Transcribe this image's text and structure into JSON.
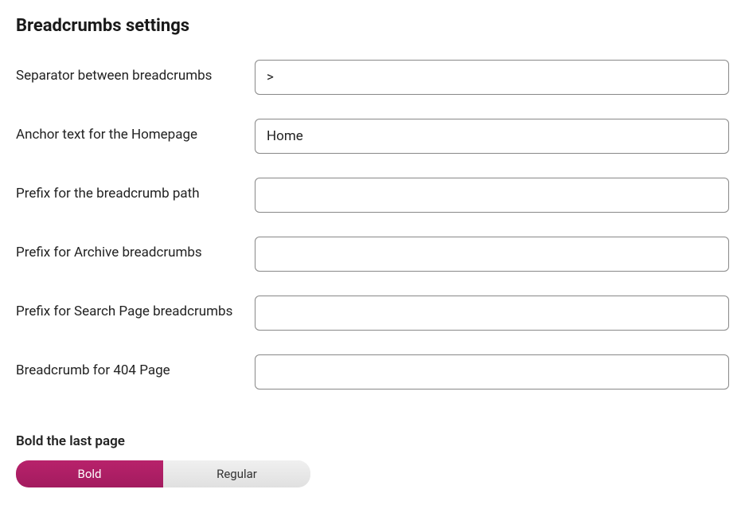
{
  "title": "Breadcrumbs settings",
  "fields": {
    "separator": {
      "label": "Separator between breadcrumbs",
      "value": ">"
    },
    "anchor_home": {
      "label": "Anchor text for the Homepage",
      "value": "Home"
    },
    "prefix_path": {
      "label": "Prefix for the breadcrumb path",
      "value": ""
    },
    "prefix_archive": {
      "label": "Prefix for Archive breadcrumbs",
      "value": ""
    },
    "prefix_search": {
      "label": "Prefix for Search Page breadcrumbs",
      "value": ""
    },
    "breadcrumb_404": {
      "label": "Breadcrumb for 404 Page",
      "value": ""
    }
  },
  "bold_toggle": {
    "label": "Bold the last page",
    "options": {
      "bold": "Bold",
      "regular": "Regular"
    },
    "selected": "bold"
  }
}
